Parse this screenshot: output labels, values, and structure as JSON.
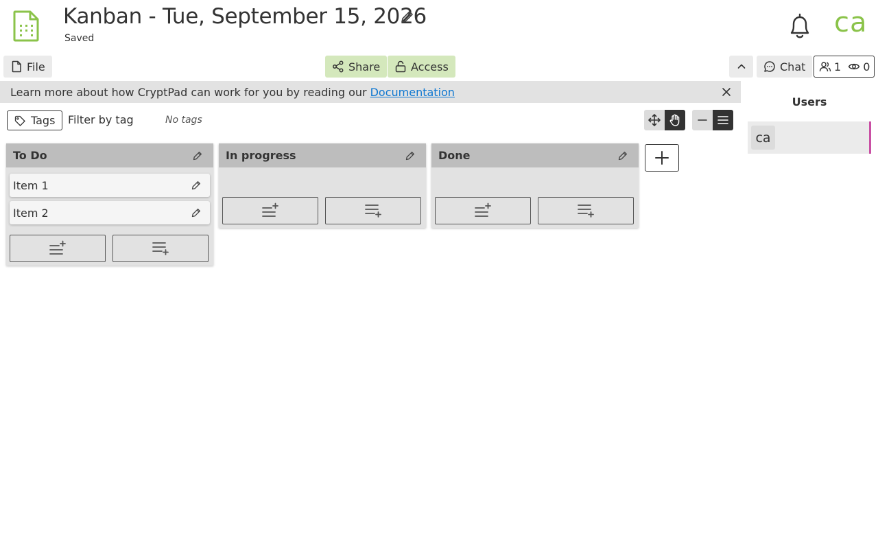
{
  "header": {
    "title": "Kanban - Tue, September 15, 2026",
    "status": "Saved",
    "avatar_initials": "ca"
  },
  "toolbar": {
    "file_label": "File",
    "share_label": "Share",
    "access_label": "Access",
    "chat_label": "Chat",
    "users_count": "1",
    "viewers_count": "0"
  },
  "infobar": {
    "text": "Learn more about how CryptPad can work for you by reading our",
    "link": "Documentation"
  },
  "tags": {
    "button_label": "Tags",
    "filter_label": "Filter by tag",
    "empty_label": "No tags"
  },
  "board": {
    "columns": [
      {
        "title": "To Do",
        "items": [
          "Item 1",
          "Item 2"
        ]
      },
      {
        "title": "In progress",
        "items": []
      },
      {
        "title": "Done",
        "items": []
      }
    ]
  },
  "users_panel": {
    "title": "Users",
    "users": [
      {
        "initials": "ca",
        "color": "#c94fa4"
      }
    ]
  },
  "colors": {
    "accent_green": "#8bc34a",
    "button_green": "#d4e8bc",
    "link_blue": "#0b76d1"
  },
  "icons": [
    "kanban-file-icon",
    "pencil-icon",
    "bell-icon",
    "file-icon",
    "share-icon",
    "unlock-icon",
    "chevron-up-icon",
    "chat-icon",
    "users-icon",
    "eye-icon",
    "close-icon",
    "tag-icon",
    "move-icon",
    "hand-icon",
    "minus-icon",
    "menu-icon",
    "add-item-top-icon",
    "add-item-bottom-icon",
    "plus-icon"
  ]
}
